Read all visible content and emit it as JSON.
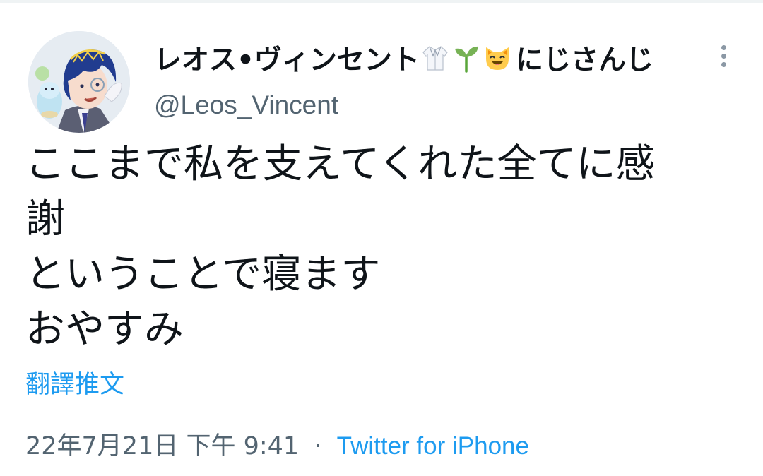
{
  "tweet": {
    "author": {
      "display_name": "レオス•ヴィンセント",
      "name_emojis": [
        "lab-coat-icon",
        "seedling-icon",
        "smiling-cat-icon"
      ],
      "org_name": "にじさんじ",
      "handle": "@Leos_Vincent"
    },
    "text_lines": [
      "ここまで私を支えてくれた全てに感",
      "謝",
      "ということで寝ます",
      "おやすみ"
    ],
    "translate_label": "翻譯推文",
    "timestamp": "22年7月21日 下午 9:41",
    "separator": "·",
    "source": "Twitter for iPhone"
  },
  "colors": {
    "text_primary": "#0f1419",
    "text_secondary": "#536471",
    "link": "#1d9bf0"
  }
}
